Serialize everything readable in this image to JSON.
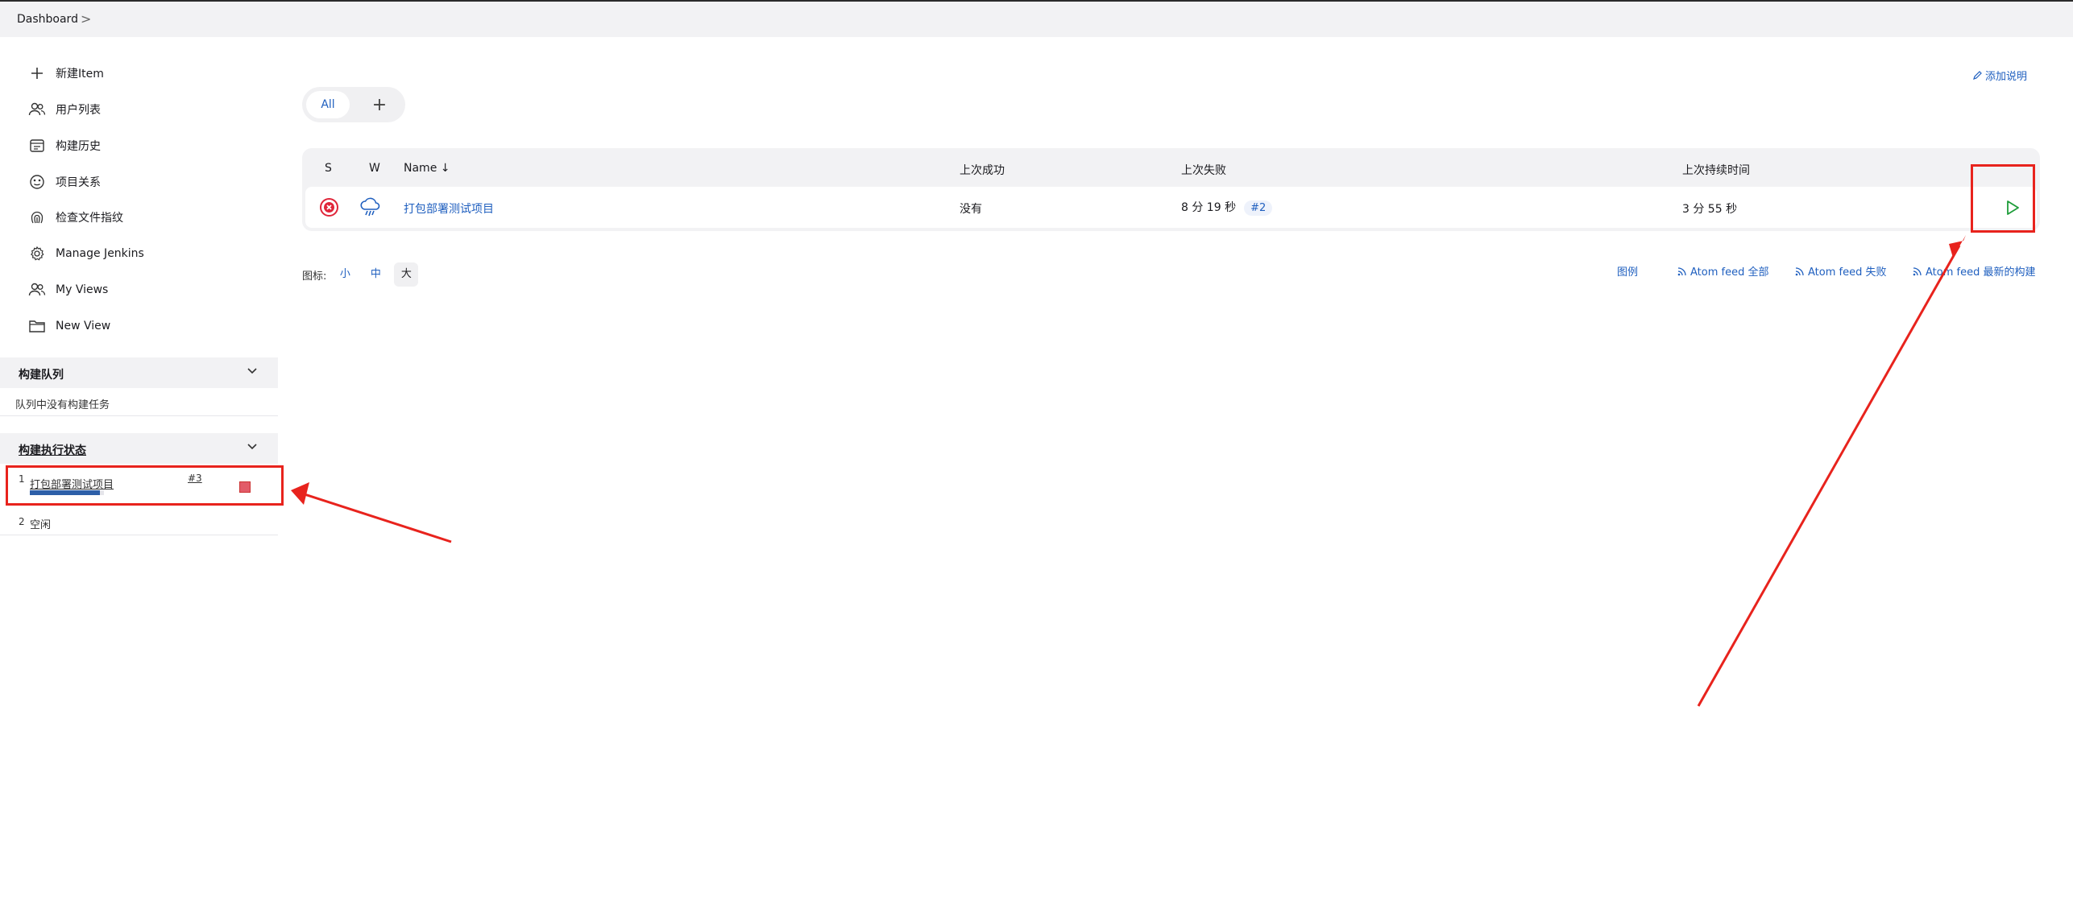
{
  "breadcrumb": {
    "item": "Dashboard",
    "separator": ">"
  },
  "sidebar": {
    "tasks": [
      {
        "label": "新建Item",
        "icon": "plus-icon"
      },
      {
        "label": "用户列表",
        "icon": "users-icon"
      },
      {
        "label": "构建历史",
        "icon": "history-icon"
      },
      {
        "label": "项目关系",
        "icon": "relationship-icon"
      },
      {
        "label": "检查文件指纹",
        "icon": "fingerprint-icon"
      },
      {
        "label": "Manage Jenkins",
        "icon": "gear-icon"
      },
      {
        "label": "My Views",
        "icon": "users-icon"
      },
      {
        "label": "New View",
        "icon": "folder-icon"
      }
    ],
    "build_queue": {
      "title": "构建队列",
      "empty_text": "队列中没有构建任务"
    },
    "executors": {
      "title": "构建执行状态",
      "items": [
        {
          "index": "1",
          "job": "打包部署测试项目",
          "build": "#3",
          "progress_fraction": 0.95
        },
        {
          "index": "2",
          "status": "空闲"
        }
      ]
    }
  },
  "main": {
    "add_description": "添加说明",
    "tabs": {
      "all": "All",
      "add": "+"
    },
    "table": {
      "headers": {
        "s": "S",
        "w": "W",
        "name": "Name ↓",
        "last_success": "上次成功",
        "last_failure": "上次失败",
        "last_duration": "上次持续时间"
      },
      "rows": [
        {
          "name": "打包部署测试项目",
          "last_success": "没有",
          "last_failure": "8 分 19 秒",
          "failure_build": "#2",
          "last_duration": "3 分 55 秒"
        }
      ]
    },
    "icon_size": {
      "label": "图标:",
      "small": "小",
      "medium": "中",
      "large": "大"
    },
    "footer_links": {
      "legend": "图例",
      "atom_all": "Atom feed 全部",
      "atom_failed": "Atom feed 失败",
      "atom_latest": "Atom feed 最新的构建"
    }
  },
  "colors": {
    "link": "#1f5fbf",
    "annotation": "#e8231d",
    "fail": "#e0263a",
    "run": "#1f9d3a"
  }
}
